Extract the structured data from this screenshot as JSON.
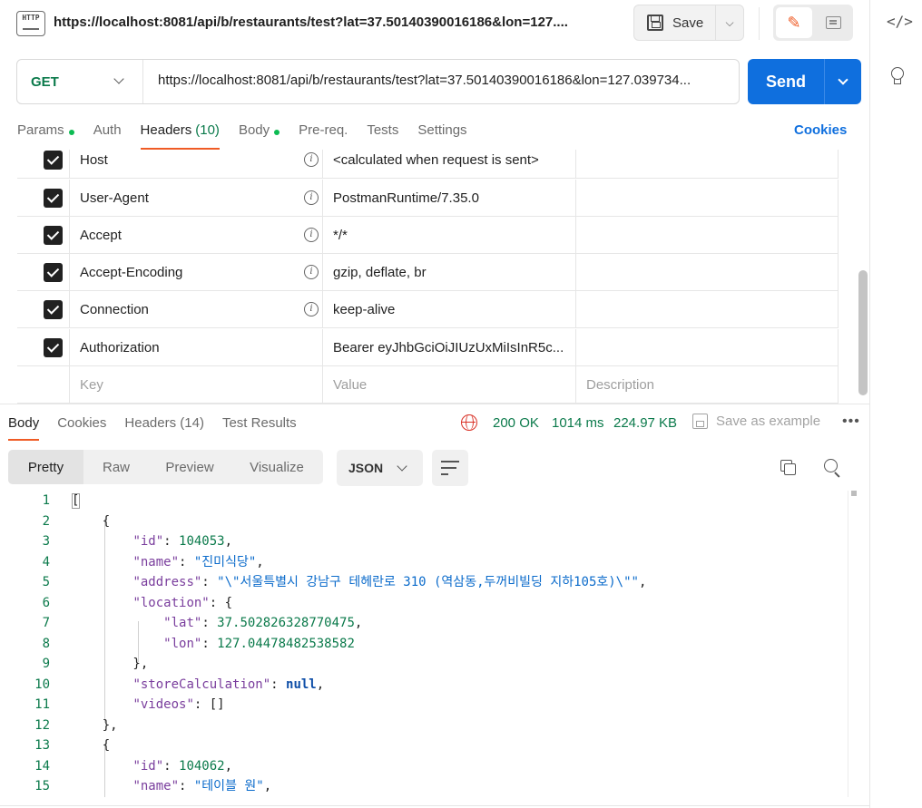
{
  "tab": {
    "title": "https://localhost:8081/api/b/restaurants/test?lat=37.50140390016186&lon=127....",
    "icon": "http-file-icon"
  },
  "toolbar": {
    "save_label": "Save"
  },
  "request": {
    "method": "GET",
    "url": "https://localhost:8081/api/b/restaurants/test?lat=37.50140390016186&lon=127.039734...",
    "send_label": "Send"
  },
  "request_tabs": [
    {
      "label": "Params",
      "dot": true
    },
    {
      "label": "Auth"
    },
    {
      "label": "Headers",
      "count": "(10)",
      "active": true
    },
    {
      "label": "Body",
      "dot": true
    },
    {
      "label": "Pre-req."
    },
    {
      "label": "Tests"
    },
    {
      "label": "Settings"
    }
  ],
  "cookies_label": "Cookies",
  "headers": [
    {
      "key": "Host",
      "value": "<calculated when request is sent>",
      "info": true
    },
    {
      "key": "User-Agent",
      "value": "PostmanRuntime/7.35.0",
      "info": true
    },
    {
      "key": "Accept",
      "value": "*/*",
      "info": true
    },
    {
      "key": "Accept-Encoding",
      "value": "gzip, deflate, br",
      "info": true
    },
    {
      "key": "Connection",
      "value": "keep-alive",
      "info": true
    },
    {
      "key": "Authorization",
      "value": "Bearer eyJhbGciOiJIUzUxMiIsInR5c...",
      "info": false
    }
  ],
  "headers_placeholder": {
    "key": "Key",
    "value": "Value",
    "description": "Description"
  },
  "response_tabs": [
    {
      "label": "Body",
      "active": true
    },
    {
      "label": "Cookies"
    },
    {
      "label": "Headers",
      "count": "(14)"
    },
    {
      "label": "Test Results"
    }
  ],
  "response_meta": {
    "status": "200 OK",
    "time": "1014 ms",
    "size": "224.97 KB",
    "save_example": "Save as example",
    "more": "•••"
  },
  "view_tabs": [
    "Pretty",
    "Raw",
    "Preview",
    "Visualize"
  ],
  "format": "JSON",
  "code_lines": [
    {
      "n": "1",
      "t": "["
    },
    {
      "n": "2",
      "t": "    {"
    },
    {
      "n": "3",
      "t": "        \"id\": 104053,"
    },
    {
      "n": "4",
      "t": "        \"name\": \"진미식당\","
    },
    {
      "n": "5",
      "t": "        \"address\": \"\\\"서울특별시 강남구 테헤란로 310 (역삼동,두꺼비빌딩 지하105호)\\\"\","
    },
    {
      "n": "6",
      "t": "        \"location\": {"
    },
    {
      "n": "7",
      "t": "            \"lat\": 37.502826328770475,"
    },
    {
      "n": "8",
      "t": "            \"lon\": 127.04478482538582"
    },
    {
      "n": "9",
      "t": "        },"
    },
    {
      "n": "10",
      "t": "        \"storeCalculation\": null,"
    },
    {
      "n": "11",
      "t": "        \"videos\": []"
    },
    {
      "n": "12",
      "t": "    },"
    },
    {
      "n": "13",
      "t": "    {"
    },
    {
      "n": "14",
      "t": "        \"id\": 104062,"
    },
    {
      "n": "15",
      "t": "        \"name\": \"테이블 원\","
    }
  ],
  "colors": {
    "accent": "#ef5b25",
    "send": "#0f6fde",
    "status_green": "#0b7a4b",
    "get_method": "#0b7a4b"
  }
}
